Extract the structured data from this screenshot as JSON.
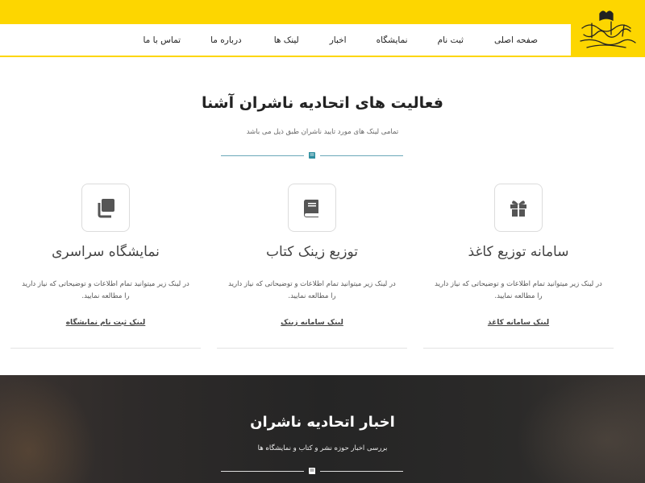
{
  "header": {
    "logo_icon": "publishers-union-calligraphy-logo",
    "accent_color": "#fdd600",
    "nav": [
      {
        "label": "صفحه اصلی"
      },
      {
        "label": "ثبت نام"
      },
      {
        "label": "نمایشگاه"
      },
      {
        "label": "اخبار"
      },
      {
        "label": "لینک ها"
      },
      {
        "label": "درباره ما"
      },
      {
        "label": "تماس با ما"
      }
    ]
  },
  "activities": {
    "title": "فعالیت های اتحادیه ناشران آشنا",
    "subtitle": "تمامی لینک های مورد تایید ناشران طبق ذیل می باشد",
    "divider_icon": "book-icon",
    "cards": [
      {
        "icon": "gift-icon",
        "title": "سامانه توزیع کاغذ",
        "description": "در لینک زیر میتوانید تمام اطلاعات و توضیحاتی که نیاز دارید را مطالعه نمایید.",
        "link": "لینک سامانه کاغذ"
      },
      {
        "icon": "book-icon",
        "title": "توزیع زینک کتاب",
        "description": "در لینک زیر میتوانید تمام اطلاعات و توضیحاتی که نیاز دارید را مطالعه نمایید.",
        "link": "لینک سامانه زینک"
      },
      {
        "icon": "copy-icon",
        "title": "نمایشگاه سراسری",
        "description": "در لینک زیر میتوانید تمام اطلاعات و توضیحاتی که نیاز دارید را مطالعه نمایید.",
        "link": "لینک ثبت نام نمایشگاه"
      }
    ]
  },
  "news": {
    "title": "اخبار اتحادیه ناشران",
    "subtitle": "بررسی اخبار حوزه نشر و کتاب و نمایشگاه ها",
    "divider_icon": "book-icon"
  }
}
